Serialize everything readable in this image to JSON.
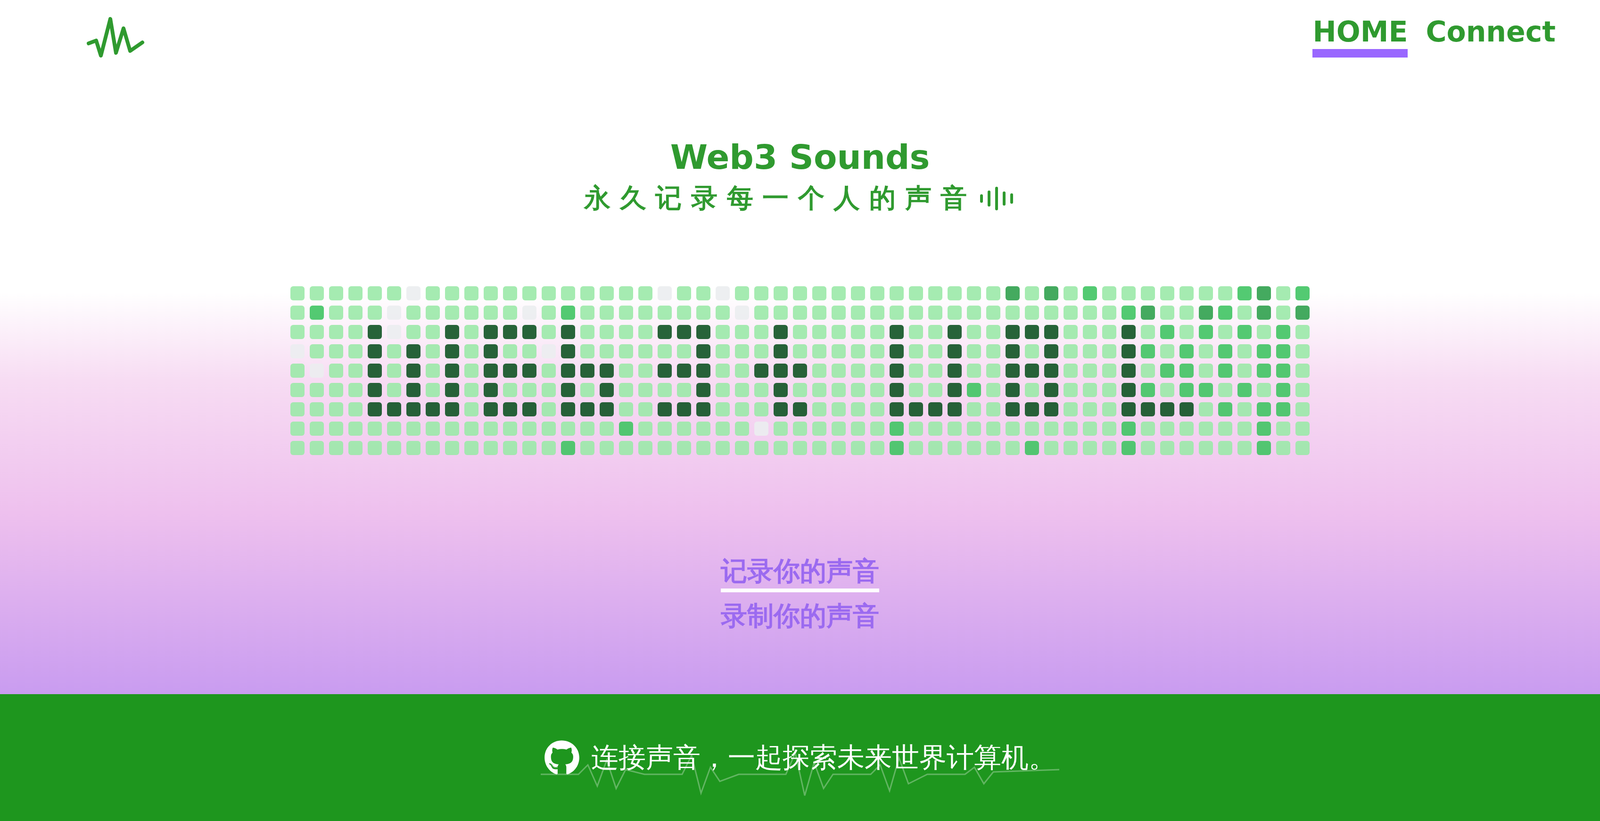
{
  "nav": {
    "items": [
      {
        "label": "HOME",
        "selected": true
      },
      {
        "label": "Connect",
        "selected": false
      }
    ]
  },
  "hero": {
    "title": "Web3 Sounds",
    "subtitle": "永久记录每一个人的声音"
  },
  "grid": {
    "intensity": [
      [
        1,
        1,
        1,
        1,
        1,
        1,
        0,
        1,
        1,
        1,
        1,
        1,
        1,
        1,
        1,
        1,
        1,
        1,
        1,
        0,
        1,
        1,
        0,
        1,
        1,
        1,
        1,
        1,
        1,
        1,
        1,
        1,
        1,
        1,
        1,
        1,
        1,
        3,
        1,
        3,
        1,
        2,
        1,
        1,
        1,
        1,
        1,
        1,
        1,
        2,
        3,
        1,
        2
      ],
      [
        1,
        2,
        1,
        1,
        1,
        0,
        1,
        1,
        1,
        1,
        1,
        1,
        0,
        1,
        2,
        1,
        1,
        1,
        1,
        1,
        1,
        1,
        1,
        0,
        1,
        1,
        1,
        1,
        1,
        1,
        1,
        1,
        1,
        1,
        1,
        1,
        1,
        1,
        1,
        1,
        1,
        1,
        1,
        2,
        3,
        1,
        1,
        3,
        2,
        1,
        3,
        1,
        3
      ],
      [
        1,
        1,
        1,
        1,
        4,
        0,
        1,
        1,
        4,
        1,
        4,
        4,
        4,
        1,
        4,
        1,
        1,
        1,
        1,
        4,
        4,
        4,
        1,
        1,
        1,
        4,
        1,
        1,
        1,
        1,
        1,
        4,
        1,
        1,
        4,
        1,
        1,
        4,
        4,
        4,
        1,
        1,
        1,
        4,
        1,
        2,
        1,
        2,
        1,
        2,
        1,
        2,
        1
      ],
      [
        0,
        1,
        1,
        1,
        4,
        1,
        4,
        1,
        4,
        1,
        4,
        1,
        1,
        0,
        4,
        1,
        1,
        1,
        1,
        1,
        1,
        4,
        1,
        1,
        1,
        4,
        1,
        1,
        1,
        1,
        1,
        4,
        1,
        1,
        4,
        1,
        1,
        4,
        1,
        4,
        1,
        1,
        1,
        4,
        2,
        1,
        2,
        1,
        2,
        1,
        2,
        2,
        1
      ],
      [
        1,
        0,
        1,
        1,
        4,
        1,
        4,
        1,
        4,
        1,
        4,
        4,
        4,
        1,
        4,
        4,
        4,
        1,
        1,
        4,
        4,
        4,
        1,
        1,
        4,
        4,
        4,
        1,
        1,
        1,
        1,
        4,
        1,
        1,
        4,
        1,
        1,
        4,
        4,
        4,
        1,
        1,
        1,
        4,
        1,
        2,
        2,
        1,
        2,
        1,
        2,
        2,
        1
      ],
      [
        1,
        1,
        1,
        1,
        4,
        1,
        4,
        1,
        4,
        1,
        4,
        1,
        1,
        1,
        4,
        1,
        4,
        1,
        1,
        1,
        1,
        4,
        1,
        1,
        1,
        4,
        1,
        1,
        1,
        1,
        1,
        4,
        1,
        1,
        4,
        2,
        1,
        4,
        1,
        4,
        1,
        1,
        1,
        4,
        2,
        1,
        2,
        2,
        1,
        2,
        1,
        2,
        1
      ],
      [
        1,
        1,
        1,
        1,
        4,
        4,
        4,
        4,
        4,
        1,
        4,
        4,
        4,
        1,
        4,
        4,
        4,
        1,
        1,
        4,
        4,
        4,
        1,
        1,
        1,
        4,
        4,
        1,
        1,
        1,
        1,
        4,
        4,
        4,
        4,
        1,
        1,
        4,
        4,
        4,
        1,
        1,
        1,
        4,
        4,
        4,
        4,
        1,
        2,
        1,
        2,
        2,
        1
      ],
      [
        1,
        1,
        1,
        1,
        1,
        1,
        1,
        1,
        1,
        1,
        1,
        1,
        1,
        1,
        1,
        1,
        1,
        2,
        1,
        1,
        1,
        1,
        1,
        1,
        0,
        1,
        1,
        1,
        1,
        1,
        1,
        2,
        1,
        1,
        1,
        1,
        1,
        1,
        1,
        1,
        1,
        1,
        1,
        2,
        1,
        1,
        1,
        1,
        1,
        1,
        2,
        1,
        1
      ],
      [
        1,
        1,
        1,
        1,
        1,
        1,
        1,
        1,
        1,
        1,
        1,
        1,
        1,
        1,
        2,
        1,
        1,
        1,
        1,
        1,
        1,
        1,
        1,
        1,
        1,
        1,
        1,
        1,
        1,
        1,
        1,
        2,
        1,
        1,
        1,
        1,
        1,
        1,
        2,
        1,
        1,
        1,
        1,
        2,
        1,
        1,
        1,
        1,
        1,
        1,
        2,
        1,
        1
      ]
    ]
  },
  "actions": [
    {
      "label": "记录你的声音",
      "selected": true
    },
    {
      "label": "录制你的声音",
      "selected": false
    }
  ],
  "footer": {
    "text": "连接声音，一起探索未来世界计算机。"
  }
}
